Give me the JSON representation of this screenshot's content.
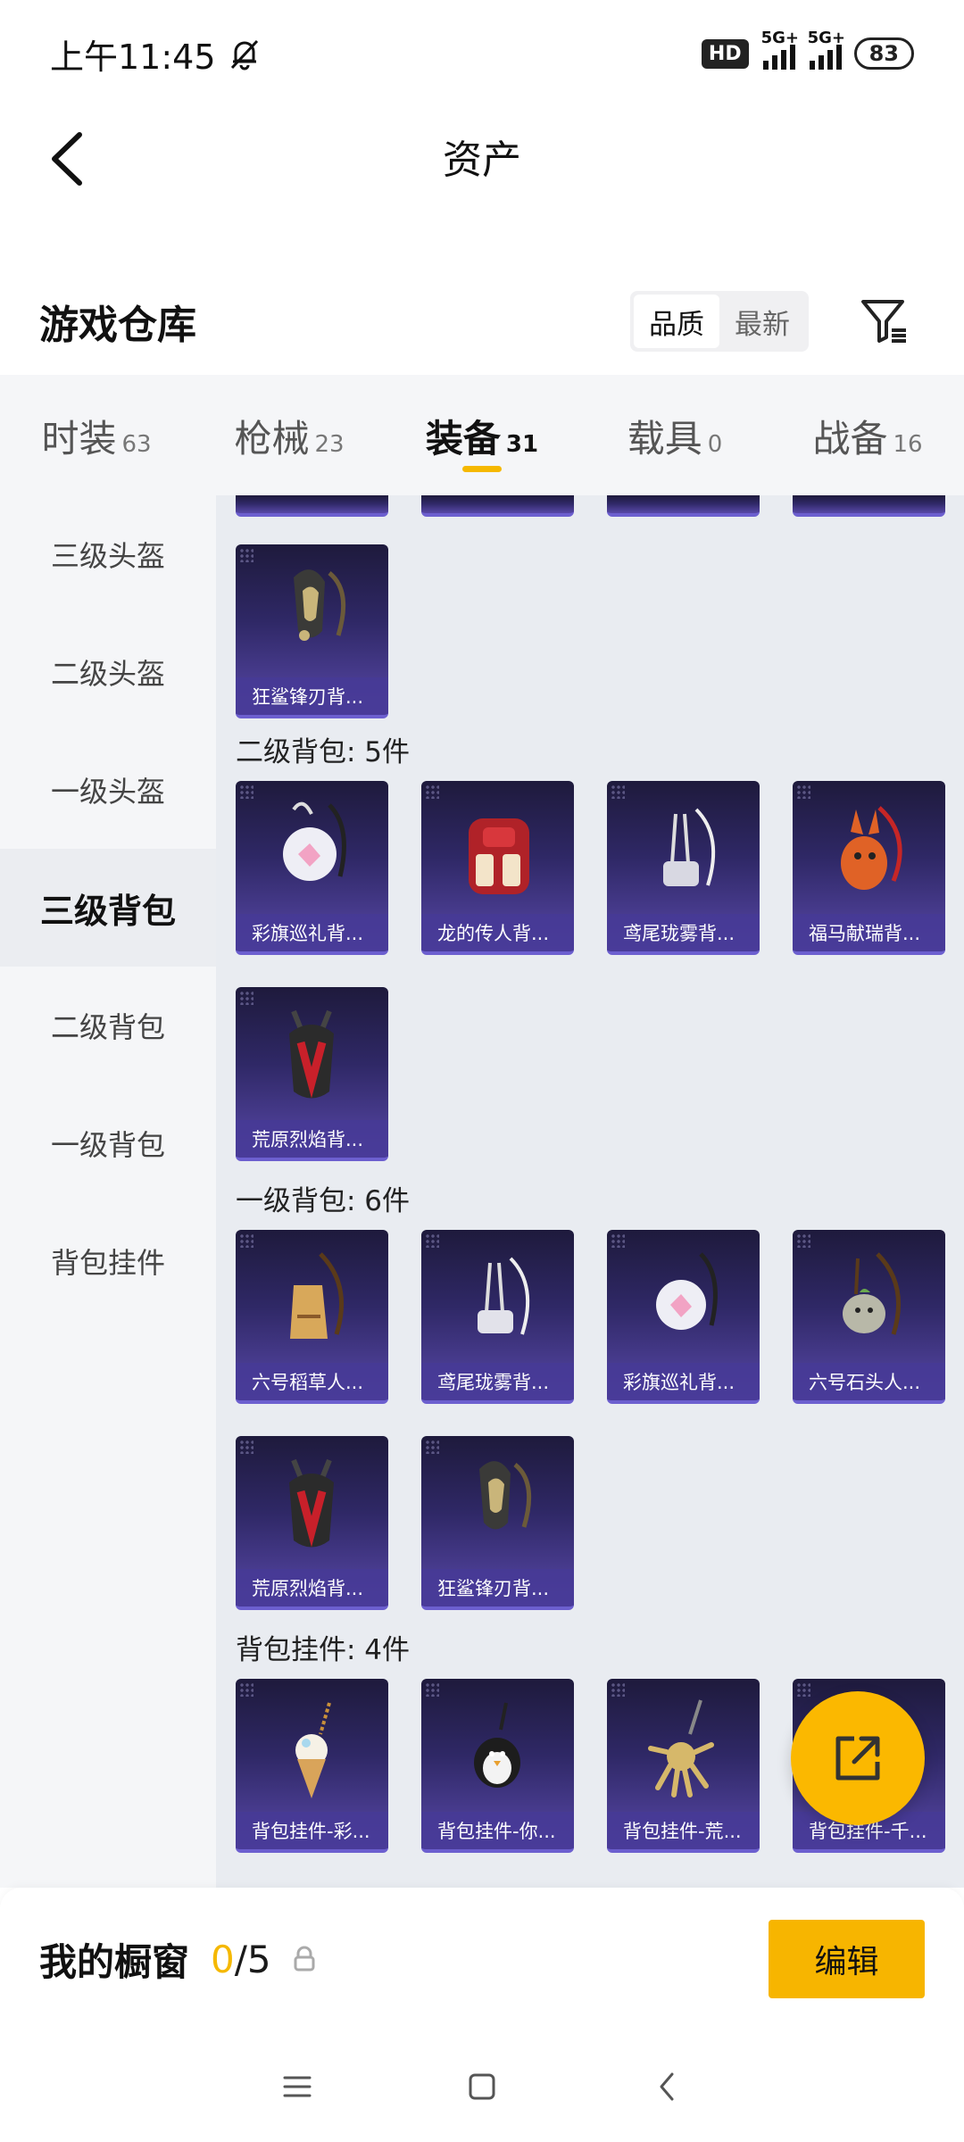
{
  "status": {
    "time": "上午11:45",
    "hd": "HD",
    "net1": "5G+",
    "net2": "5G+",
    "battery": "83"
  },
  "header": {
    "title": "资产"
  },
  "warehouse": {
    "title": "游戏仓库",
    "sort_quality": "品质",
    "sort_newest": "最新"
  },
  "tabs": [
    {
      "label": "时装",
      "count": "63"
    },
    {
      "label": "枪械",
      "count": "23"
    },
    {
      "label": "装备",
      "count": "31"
    },
    {
      "label": "载具",
      "count": "0"
    },
    {
      "label": "战备",
      "count": "16"
    }
  ],
  "sidebar": [
    "三级头盔",
    "二级头盔",
    "一级头盔",
    "三级背包",
    "二级背包",
    "一级背包",
    "背包挂件"
  ],
  "sections": {
    "top_partial": [],
    "lvl3_backpack_items": [
      "狂鲨锋刃背..."
    ],
    "lvl2_title": "二级背包: 5件",
    "lvl2_items": [
      "彩旗巡礼背...",
      "龙的传人背...",
      "鸢尾珑雾背...",
      "福马献瑞背...",
      "荒原烈焰背..."
    ],
    "lvl1_title": "一级背包: 6件",
    "lvl1_items": [
      "六号稻草人...",
      "鸢尾珑雾背...",
      "彩旗巡礼背...",
      "六号石头人...",
      "荒原烈焰背...",
      "狂鲨锋刃背..."
    ],
    "pendant_title": "背包挂件: 4件",
    "pendant_items": [
      "背包挂件-彩...",
      "背包挂件-你...",
      "背包挂件-荒...",
      "背包挂件-千..."
    ]
  },
  "showcase": {
    "title": "我的橱窗",
    "current": "0",
    "total": "/5",
    "edit_label": "编辑"
  }
}
